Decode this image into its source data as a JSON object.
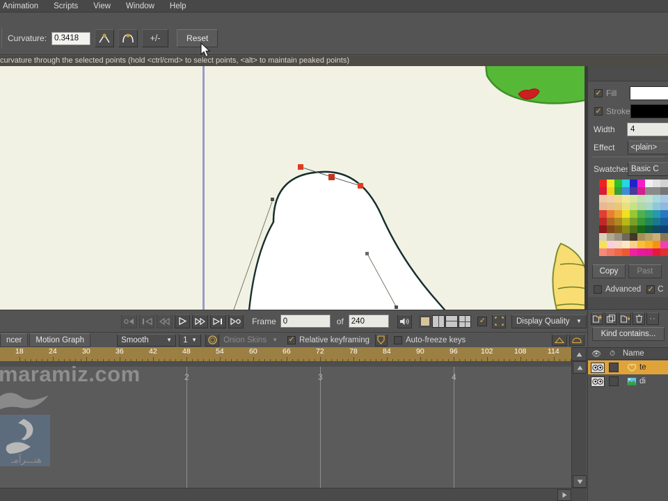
{
  "menubar": {
    "items": [
      {
        "label": "Animation"
      },
      {
        "label": "Scripts"
      },
      {
        "label": "View"
      },
      {
        "label": "Window"
      },
      {
        "label": "Help"
      }
    ]
  },
  "tool_options": {
    "curvature_label": "Curvature:",
    "curvature_value": "0.3418",
    "peak_button": "peak-curve-icon",
    "smooth_button": "smooth-curve-icon",
    "toggle_button": "+/-",
    "reset_button": "Reset"
  },
  "hint_bar": {
    "text": "curvature through the selected points (hold <ctrl/cmd> to select points, <alt> to maintain peaked points)"
  },
  "canvas": {
    "background": "#f2f2e4",
    "guide_color": "#9a9ac8",
    "shape_fill": "#ffffff",
    "shape_stroke": "#16302e",
    "handle_selected_color": "#e03b20",
    "handle_color": "#606060",
    "green_blob": "#56b837",
    "green_blob_stroke": "#3f8f28",
    "red_detail": "#cc1f1f",
    "yellow_body": "#f7dd72",
    "yellow_stroke": "#7c8c2c"
  },
  "playback": {
    "buttons": [
      {
        "name": "loop-start-icon"
      },
      {
        "name": "jump-start-icon"
      },
      {
        "name": "step-back-icon"
      },
      {
        "name": "play-icon"
      },
      {
        "name": "fast-forward-icon"
      },
      {
        "name": "jump-end-icon"
      },
      {
        "name": "loop-end-icon"
      }
    ],
    "frame_label": "Frame",
    "frame_value": "0",
    "of_label": "of",
    "total_frames": "240",
    "audio_icon": "speaker-icon",
    "view_layouts": [
      "single-view-icon",
      "two-pane-icon",
      "split-horizontal-icon",
      "quad-view-icon"
    ],
    "freeze_checked": true,
    "crop_icon": "crop-icon",
    "display_quality_label": "Display Quality"
  },
  "anim_bar": {
    "tab_sequencer": "ncer",
    "tab_motion_graph": "Motion Graph",
    "interp_value": "Smooth",
    "interp_count": "1",
    "onion_icon": "onion-skin-icon",
    "onion_label": "Onion Skins",
    "relative_keyframing_label": "Relative keyframing",
    "relative_keyframing_checked": true,
    "shield_icon": "shield-icon",
    "auto_freeze_label": "Auto-freeze keys",
    "auto_freeze_checked": false,
    "right_icon_1": "peak-key-icon",
    "right_icon_2": "smooth-key-icon"
  },
  "timeline": {
    "ruler_ticks": [
      "18",
      "24",
      "30",
      "36",
      "42",
      "48",
      "54",
      "60",
      "66",
      "72",
      "78",
      "84",
      "90",
      "96",
      "102",
      "108",
      "114"
    ],
    "ruler_bg": "#9c8043",
    "key_markers": [
      "2",
      "3",
      "4"
    ],
    "scroll_up_icon": "scroll-up-icon",
    "scroll_down_icon": "scroll-down-icon",
    "scroll_right_icon": "scroll-right-icon"
  },
  "watermark": {
    "text": "maramiz.com",
    "persian_text": "هنـــرآمـ"
  },
  "right_panel": {
    "style": {
      "fill_label": "Fill",
      "fill_checked": true,
      "fill_color": "#ffffff",
      "stroke_label": "Stroke",
      "stroke_checked": true,
      "stroke_color": "#000000",
      "width_label": "Width",
      "width_value": "4",
      "effect_label": "Effect",
      "effect_value": "<plain>",
      "swatches_label": "Swatches",
      "swatches_value": "Basic C",
      "copy_button": "Copy",
      "paste_button": "Past",
      "advanced_label": "Advanced",
      "advanced_checked": false,
      "last_checked": true
    },
    "palette_colors": [
      "#ef2222",
      "#f5e72c",
      "#2bbf2b",
      "#2ad4e2",
      "#2222c8",
      "#f020c8",
      "#f0f0f0",
      "#e2e2e2",
      "#d2d2d2",
      "#d81d3c",
      "#f5d21a",
      "#3a9d3a",
      "#3a8fd8",
      "#4a3a9d",
      "#d81d8f",
      "#8a8a8a",
      "#8a8a8a",
      "#757575",
      "#f0c8a8",
      "#f0d0a8",
      "#f0d890",
      "#f0e898",
      "#d8e8a0",
      "#c0e0b8",
      "#c0e0d0",
      "#a8d8e0",
      "#a8c8e8",
      "#e8b894",
      "#e8c08c",
      "#e8c878",
      "#e8e080",
      "#c8e088",
      "#b0d8a8",
      "#a8d8c8",
      "#90c8d8",
      "#90b8e0",
      "#e04030",
      "#e88030",
      "#e8a830",
      "#f0e020",
      "#98c830",
      "#50b050",
      "#30a878",
      "#2898b0",
      "#2878c0",
      "#c02828",
      "#b06820",
      "#b08820",
      "#b8b818",
      "#78a028",
      "#389838",
      "#208858",
      "#187890",
      "#1860a0",
      "#901818",
      "#804818",
      "#806018",
      "#888818",
      "#507018",
      "#186818",
      "#105840",
      "#104860",
      "#104070",
      "#d8d0b8",
      "#b0a890",
      "#989080",
      "#706858",
      "#403828",
      "#a89058",
      "#b8a068",
      "#c8b078",
      "#8a7850",
      "#f8e058",
      "#f8d0e0",
      "#f8d8c0",
      "#f8e8c8",
      "#f8d088",
      "#f8c038",
      "#f8b020",
      "#f89018",
      "#f040b8",
      "#f88878",
      "#f07860",
      "#f06848",
      "#f05830",
      "#f020a0",
      "#e818a0",
      "#e81890",
      "#e81838",
      "#e03030"
    ],
    "layers_toolbar": {
      "new_layer_icon": "new-layer-icon",
      "duplicate_layer_icon": "duplicate-layer-icon",
      "new_group_icon": "new-group-icon",
      "delete_layer_icon": "trash-icon",
      "more_icon": "more-options-icon",
      "search_placeholder": "Kind contains..."
    },
    "layers_header": {
      "visibility_icon": "eye-icon",
      "lock_icon": "timer-icon",
      "name_label": "Name"
    },
    "layers": [
      {
        "name": "te",
        "type_icon": "vector-layer-icon",
        "visible": true,
        "locked": false,
        "selected": true
      },
      {
        "name": "di",
        "type_icon": "image-layer-icon",
        "visible": true,
        "locked": false,
        "selected": false
      }
    ]
  }
}
